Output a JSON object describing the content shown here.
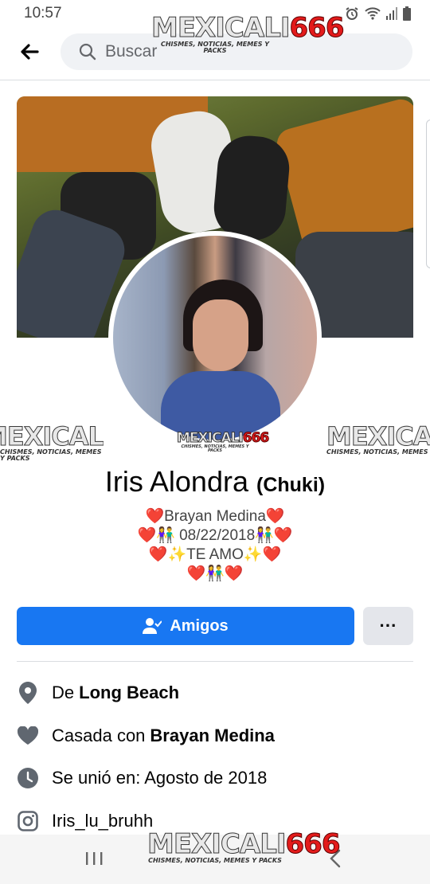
{
  "status_bar": {
    "time": "10:57"
  },
  "search": {
    "placeholder": "Buscar"
  },
  "watermark": {
    "part1": "MEXICALI",
    "part2": "666",
    "tagline": "CHISMES, NOTICIAS, MEMES Y PACKS"
  },
  "profile": {
    "name": "Iris Alondra",
    "alt_name": "(Chuki)",
    "bio_lines": [
      "❤️Brayan Medina❤️",
      "❤️👫 08/22/2018👫❤️",
      "❤️✨TE AMO✨❤️",
      "❤️👫❤️"
    ]
  },
  "actions": {
    "friends_label": "Amigos",
    "more_label": "···"
  },
  "details": {
    "from_prefix": "De",
    "from_value": "Long Beach",
    "married_prefix": "Casada con",
    "married_value": "Brayan Medina",
    "joined": "Se unió en: Agosto de 2018",
    "instagram": "Iris_lu_bruhh"
  },
  "colors": {
    "primary": "#1877f2",
    "secondary_button": "#e4e6eb",
    "icon_gray": "#606770"
  },
  "icons": [
    "back-arrow-icon",
    "search-icon",
    "friends-check-icon",
    "location-pin-icon",
    "heart-icon",
    "clock-icon",
    "instagram-icon",
    "recents-icon",
    "back-nav-icon"
  ]
}
